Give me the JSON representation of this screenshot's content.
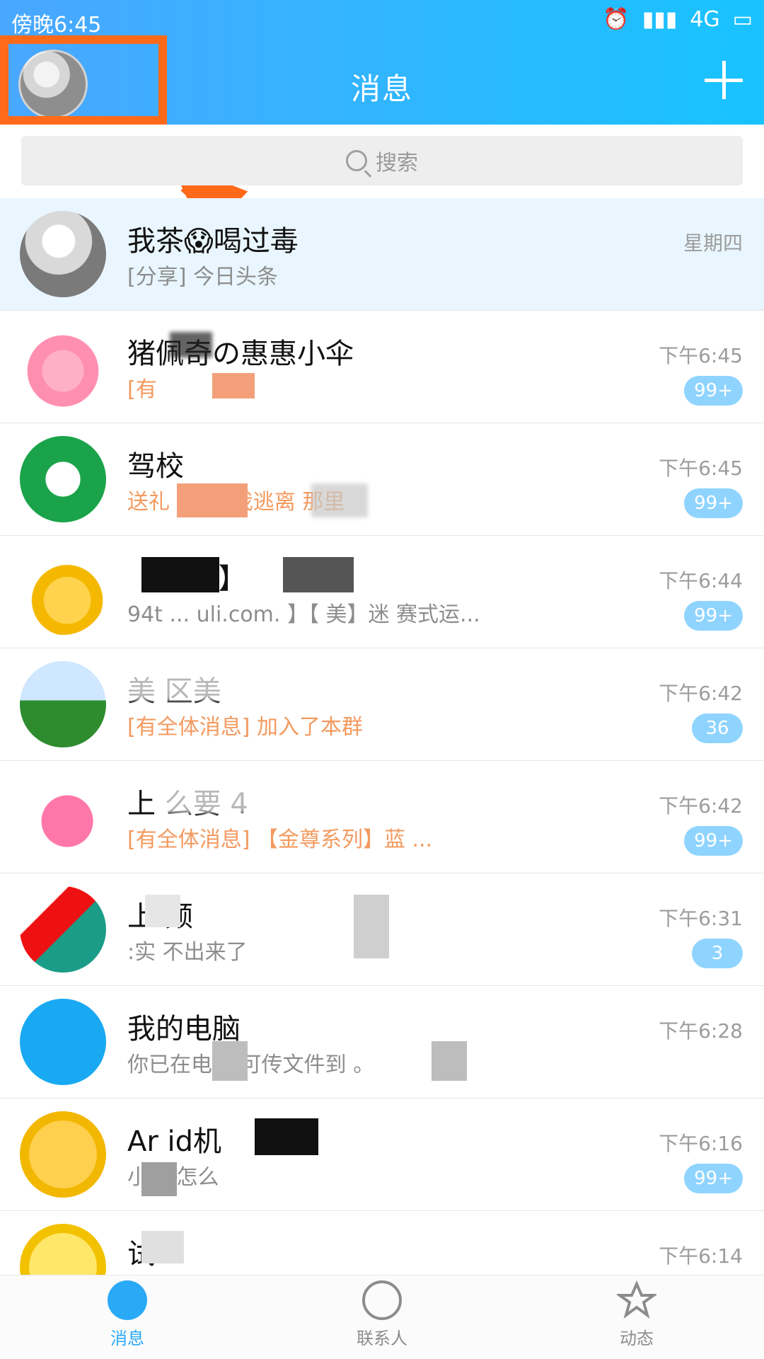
{
  "status_bar": {
    "time": "傍晚6:45",
    "network": "4G"
  },
  "header": {
    "title": "消息"
  },
  "search": {
    "placeholder": "搜索"
  },
  "chats": [
    {
      "name": "我茶😱喝过毒",
      "preview": "[分享] 今日头条",
      "time": "星期四",
      "badge": "",
      "pinned": true
    },
    {
      "name": "猪佩奇の惠惠小伞",
      "preview": "[有",
      "time": "下午6:45",
      "badge": "99+",
      "preview_style": "alert"
    },
    {
      "name": "驾校",
      "preview": "送礼 林:... 我逃离 那里",
      "time": "下午6:45",
      "badge": "99+",
      "preview_style": "alert"
    },
    {
      "name": "【淘 ③】",
      "preview": "94t ... uli.com. 】【 美】迷 赛式运...",
      "time": "下午6:44",
      "badge": "99+"
    },
    {
      "name": "美 区美",
      "preview": "[有全体消息] 加入了本群",
      "time": "下午6:42",
      "badge": "36",
      "preview_style": "alert"
    },
    {
      "name": "上 么要 4",
      "preview": "[有全体消息] 【金尊系列】蓝 ...",
      "time": "下午6:42",
      "badge": "99+",
      "preview_style": "alert"
    },
    {
      "name": "上 频",
      "preview": ":实 不出来了",
      "time": "下午6:31",
      "badge": "3"
    },
    {
      "name": "我的电脑",
      "preview": "你已在电 ，可传文件到 。",
      "time": "下午6:28",
      "badge": ""
    },
    {
      "name": "Ar id机",
      "preview": "小 由怎么",
      "time": "下午6:16",
      "badge": "99+"
    },
    {
      "name": "试",
      "preview": "",
      "time": "下午6:14",
      "badge": ""
    }
  ],
  "tabbar": {
    "tabs": [
      {
        "label": "消息",
        "active": true
      },
      {
        "label": "联系人",
        "active": false
      },
      {
        "label": "动态",
        "active": false
      }
    ]
  },
  "colors": {
    "accent": "#2aa9f6",
    "header_gradient": [
      "#4aa7ff",
      "#18c3ff"
    ],
    "annotation": "#ff6a1a",
    "badge": "#8fd4ff"
  }
}
